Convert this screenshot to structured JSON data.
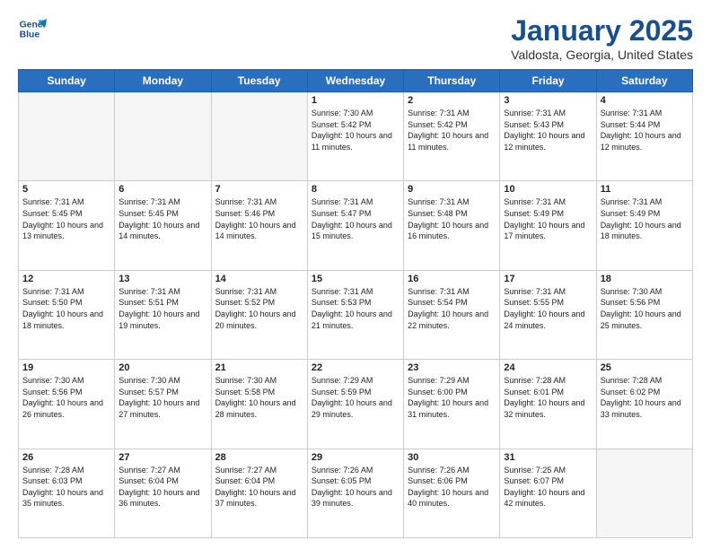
{
  "header": {
    "logo_line1": "General",
    "logo_line2": "Blue",
    "title": "January 2025",
    "subtitle": "Valdosta, Georgia, United States"
  },
  "days_of_week": [
    "Sunday",
    "Monday",
    "Tuesday",
    "Wednesday",
    "Thursday",
    "Friday",
    "Saturday"
  ],
  "weeks": [
    [
      {
        "day": "",
        "empty": true
      },
      {
        "day": "",
        "empty": true
      },
      {
        "day": "",
        "empty": true
      },
      {
        "day": "1",
        "sunrise": "7:30 AM",
        "sunset": "5:42 PM",
        "daylight": "10 hours and 11 minutes."
      },
      {
        "day": "2",
        "sunrise": "7:31 AM",
        "sunset": "5:42 PM",
        "daylight": "10 hours and 11 minutes."
      },
      {
        "day": "3",
        "sunrise": "7:31 AM",
        "sunset": "5:43 PM",
        "daylight": "10 hours and 12 minutes."
      },
      {
        "day": "4",
        "sunrise": "7:31 AM",
        "sunset": "5:44 PM",
        "daylight": "10 hours and 12 minutes."
      }
    ],
    [
      {
        "day": "5",
        "sunrise": "7:31 AM",
        "sunset": "5:45 PM",
        "daylight": "10 hours and 13 minutes."
      },
      {
        "day": "6",
        "sunrise": "7:31 AM",
        "sunset": "5:45 PM",
        "daylight": "10 hours and 14 minutes."
      },
      {
        "day": "7",
        "sunrise": "7:31 AM",
        "sunset": "5:46 PM",
        "daylight": "10 hours and 14 minutes."
      },
      {
        "day": "8",
        "sunrise": "7:31 AM",
        "sunset": "5:47 PM",
        "daylight": "10 hours and 15 minutes."
      },
      {
        "day": "9",
        "sunrise": "7:31 AM",
        "sunset": "5:48 PM",
        "daylight": "10 hours and 16 minutes."
      },
      {
        "day": "10",
        "sunrise": "7:31 AM",
        "sunset": "5:49 PM",
        "daylight": "10 hours and 17 minutes."
      },
      {
        "day": "11",
        "sunrise": "7:31 AM",
        "sunset": "5:49 PM",
        "daylight": "10 hours and 18 minutes."
      }
    ],
    [
      {
        "day": "12",
        "sunrise": "7:31 AM",
        "sunset": "5:50 PM",
        "daylight": "10 hours and 18 minutes."
      },
      {
        "day": "13",
        "sunrise": "7:31 AM",
        "sunset": "5:51 PM",
        "daylight": "10 hours and 19 minutes."
      },
      {
        "day": "14",
        "sunrise": "7:31 AM",
        "sunset": "5:52 PM",
        "daylight": "10 hours and 20 minutes."
      },
      {
        "day": "15",
        "sunrise": "7:31 AM",
        "sunset": "5:53 PM",
        "daylight": "10 hours and 21 minutes."
      },
      {
        "day": "16",
        "sunrise": "7:31 AM",
        "sunset": "5:54 PM",
        "daylight": "10 hours and 22 minutes."
      },
      {
        "day": "17",
        "sunrise": "7:31 AM",
        "sunset": "5:55 PM",
        "daylight": "10 hours and 24 minutes."
      },
      {
        "day": "18",
        "sunrise": "7:30 AM",
        "sunset": "5:56 PM",
        "daylight": "10 hours and 25 minutes."
      }
    ],
    [
      {
        "day": "19",
        "sunrise": "7:30 AM",
        "sunset": "5:56 PM",
        "daylight": "10 hours and 26 minutes."
      },
      {
        "day": "20",
        "sunrise": "7:30 AM",
        "sunset": "5:57 PM",
        "daylight": "10 hours and 27 minutes."
      },
      {
        "day": "21",
        "sunrise": "7:30 AM",
        "sunset": "5:58 PM",
        "daylight": "10 hours and 28 minutes."
      },
      {
        "day": "22",
        "sunrise": "7:29 AM",
        "sunset": "5:59 PM",
        "daylight": "10 hours and 29 minutes."
      },
      {
        "day": "23",
        "sunrise": "7:29 AM",
        "sunset": "6:00 PM",
        "daylight": "10 hours and 31 minutes."
      },
      {
        "day": "24",
        "sunrise": "7:28 AM",
        "sunset": "6:01 PM",
        "daylight": "10 hours and 32 minutes."
      },
      {
        "day": "25",
        "sunrise": "7:28 AM",
        "sunset": "6:02 PM",
        "daylight": "10 hours and 33 minutes."
      }
    ],
    [
      {
        "day": "26",
        "sunrise": "7:28 AM",
        "sunset": "6:03 PM",
        "daylight": "10 hours and 35 minutes."
      },
      {
        "day": "27",
        "sunrise": "7:27 AM",
        "sunset": "6:04 PM",
        "daylight": "10 hours and 36 minutes."
      },
      {
        "day": "28",
        "sunrise": "7:27 AM",
        "sunset": "6:04 PM",
        "daylight": "10 hours and 37 minutes."
      },
      {
        "day": "29",
        "sunrise": "7:26 AM",
        "sunset": "6:05 PM",
        "daylight": "10 hours and 39 minutes."
      },
      {
        "day": "30",
        "sunrise": "7:26 AM",
        "sunset": "6:06 PM",
        "daylight": "10 hours and 40 minutes."
      },
      {
        "day": "31",
        "sunrise": "7:25 AM",
        "sunset": "6:07 PM",
        "daylight": "10 hours and 42 minutes."
      },
      {
        "day": "",
        "empty": true
      }
    ]
  ]
}
